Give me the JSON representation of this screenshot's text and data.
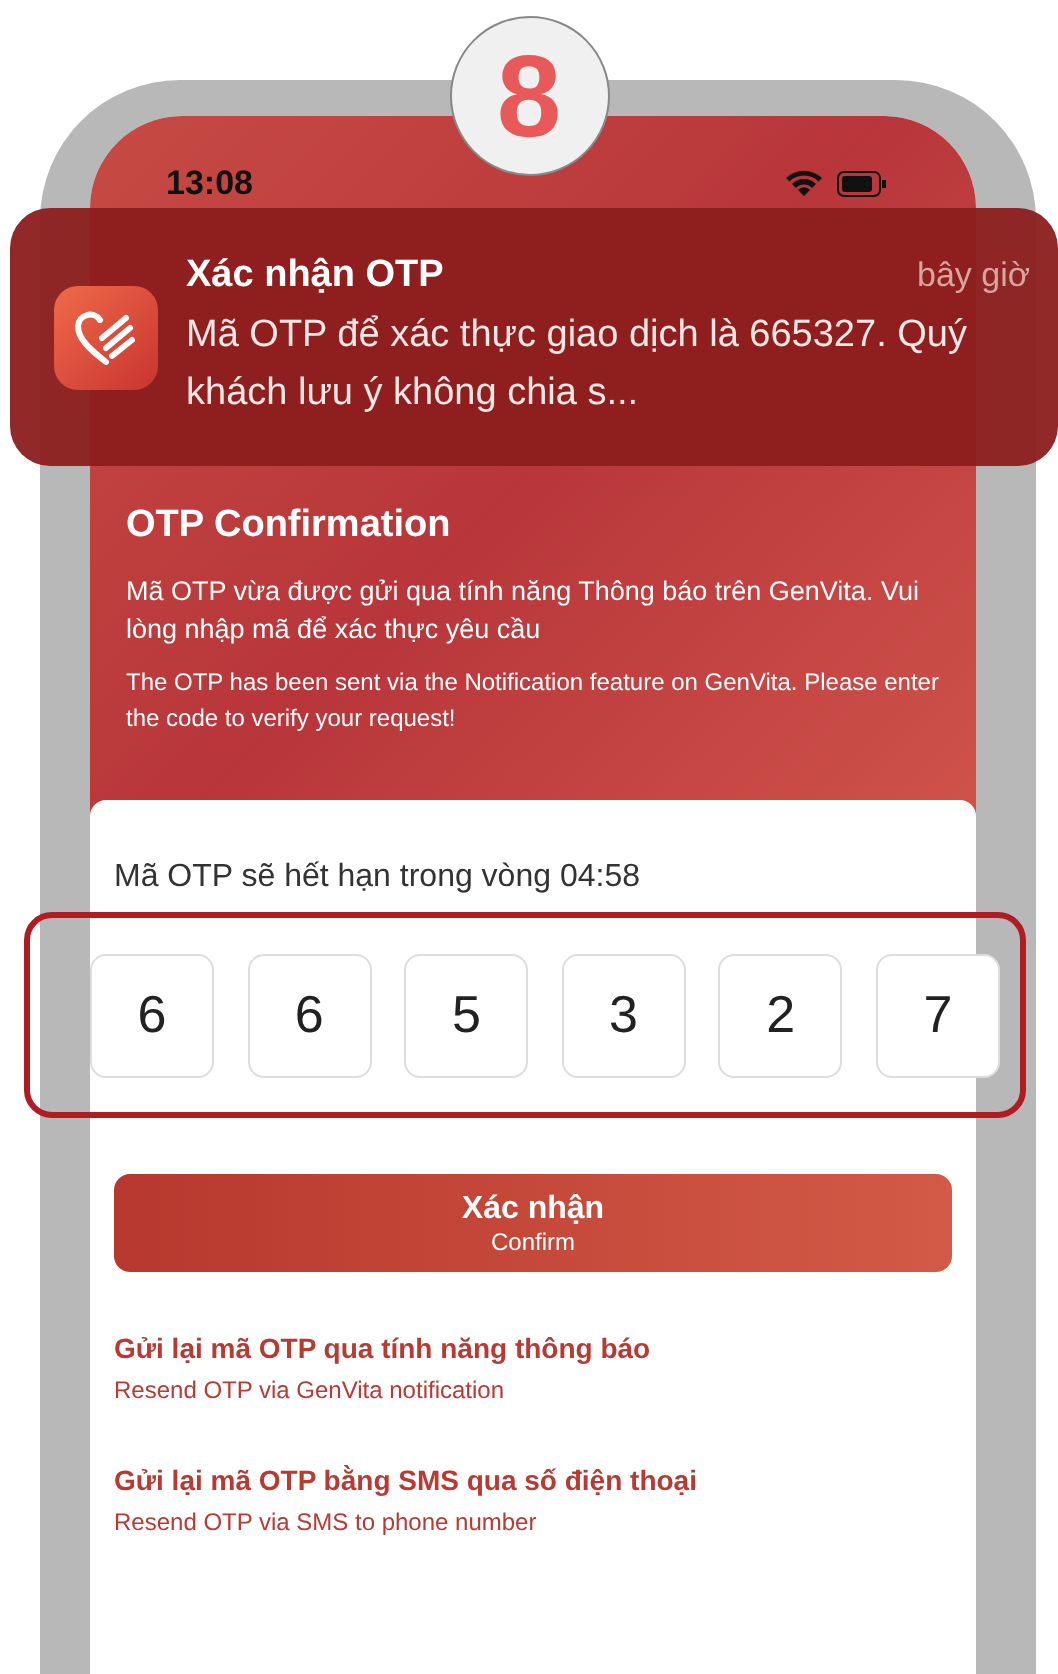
{
  "badge": "8",
  "status_bar": {
    "time": "13:08"
  },
  "notification": {
    "app_title": "Xác nhận OTP",
    "time": "bây giờ",
    "message": "Mã OTP để xác thực giao dịch là 665327. Quý khách lưu ý không chia s..."
  },
  "header": {
    "subtitle": "OTP Confirmation",
    "text_vi": "Mã OTP vừa được gửi qua tính năng Thông báo trên GenVita. Vui lòng nhập mã để xác thực yêu cầu",
    "text_en": "The OTP has been sent via the Notification feature on GenVita. Please enter the code to verify your request!"
  },
  "expiry": "Mã OTP sẽ hết hạn trong vòng 04:58",
  "otp_digits": [
    "6",
    "6",
    "5",
    "3",
    "2",
    "7"
  ],
  "confirm_button": {
    "label": "Xác nhận",
    "sublabel": "Confirm"
  },
  "resend_options": [
    {
      "title": "Gửi lại mã OTP qua tính năng thông báo",
      "subtitle": "Resend OTP via GenVita notification"
    },
    {
      "title": "Gửi lại mã OTP bằng SMS qua số điện thoại",
      "subtitle": "Resend OTP via SMS to phone number"
    }
  ]
}
